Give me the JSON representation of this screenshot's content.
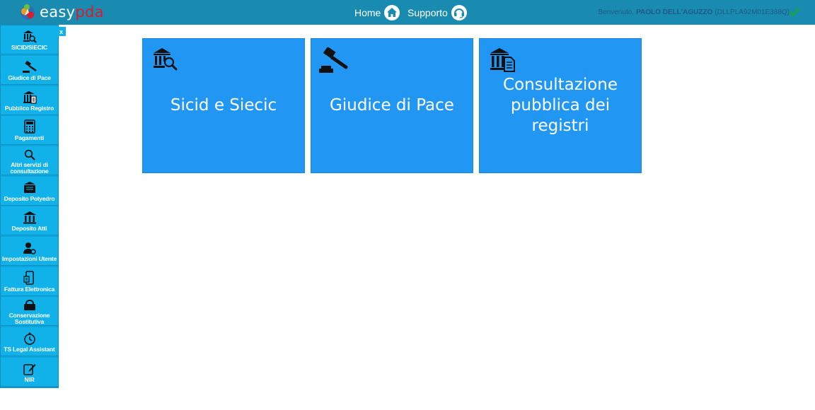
{
  "header": {
    "logo": {
      "part1": "easy",
      "part2": "pda"
    },
    "nav": [
      {
        "label": "Home",
        "icon": "home-icon"
      },
      {
        "label": "Supporto",
        "icon": "headset-icon"
      }
    ],
    "welcome": {
      "prefix": "Benvenuto,",
      "user": "PAOLO DELL'AGUZZO",
      "code": "(DLLPLA92M01E388Q)",
      "status_icon": "check-icon"
    },
    "colors": {
      "bar": "#1a8bb0",
      "brand_red": "#d81e2c",
      "check": "#16a34a"
    }
  },
  "sidebar": {
    "close_label": "x",
    "items": [
      {
        "label": "SICID/SIECIC",
        "icon": "courthouse-search-icon"
      },
      {
        "label": "Giudice di Pace",
        "icon": "gavel-icon"
      },
      {
        "label": "Pubblico Registro",
        "icon": "registry-icon"
      },
      {
        "label": "Pagamenti",
        "icon": "calculator-icon"
      },
      {
        "label": "Altri servizi di consultazione",
        "icon": "search-icon"
      },
      {
        "label": "Deposito Polyedro",
        "icon": "deposit-icon"
      },
      {
        "label": "Deposito Atti",
        "icon": "courthouse-icon"
      },
      {
        "label": "Impostazioni Utente",
        "icon": "user-settings-icon"
      },
      {
        "label": "Fattura Elettronica",
        "icon": "invoice-phone-icon"
      },
      {
        "label": "Conservazione Sostitutiva",
        "icon": "archive-icon"
      },
      {
        "label": "TS Legal Assistant",
        "icon": "clock-assistant-icon"
      },
      {
        "label": "NIR",
        "icon": "edit-icon"
      }
    ],
    "colors": {
      "bg": "#11b2ea"
    }
  },
  "tiles": [
    {
      "title": "Sicid e Siecic",
      "icon": "courthouse-search-icon"
    },
    {
      "title": "Giudice di Pace",
      "icon": "gavel-icon"
    },
    {
      "title": "Consultazione pubblica dei registri",
      "icon": "registry-icon"
    }
  ],
  "tile_color": "#2196f3"
}
